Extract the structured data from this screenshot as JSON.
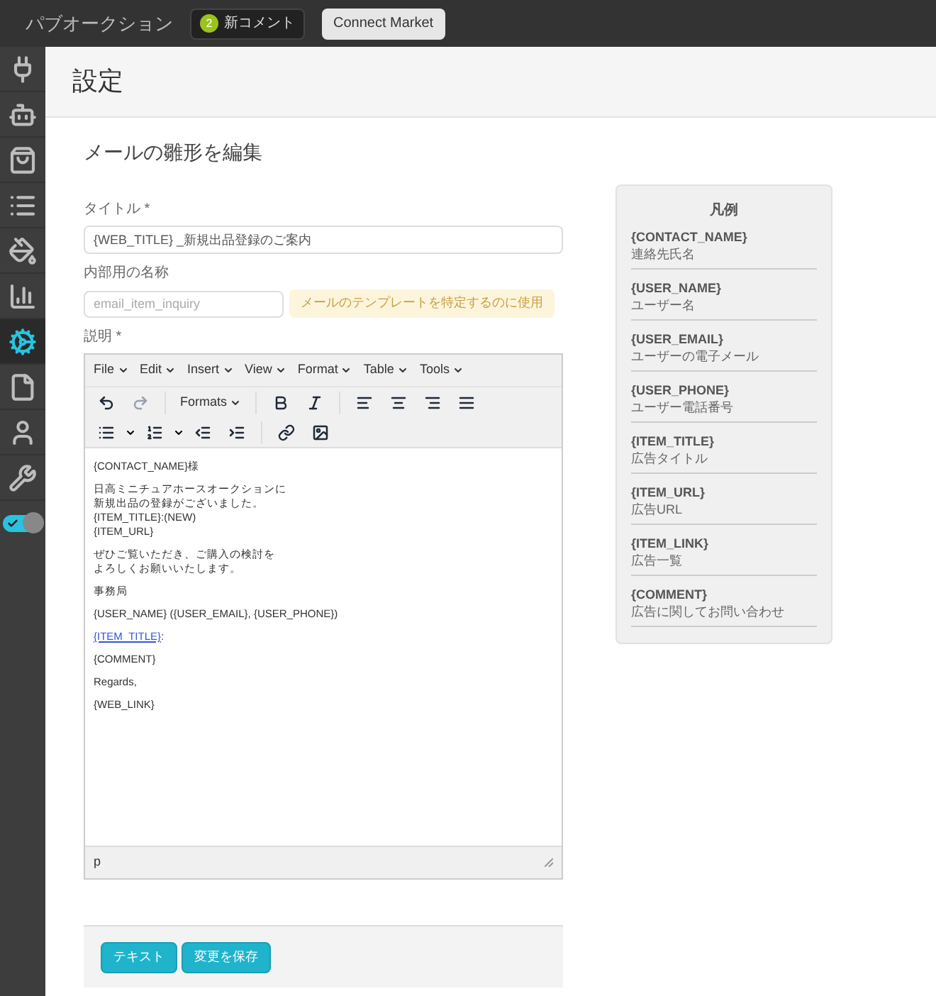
{
  "topbar": {
    "brand": "パブオークション",
    "notification": {
      "count": "2",
      "label": "新コメント"
    },
    "button": "Connect Market"
  },
  "sidebar": {
    "items": [
      {
        "selected": false
      },
      {
        "selected": false
      },
      {
        "selected": false
      },
      {
        "selected": false
      },
      {
        "selected": false
      },
      {
        "selected": false
      },
      {
        "selected": true
      },
      {
        "selected": false
      },
      {
        "selected": false
      },
      {
        "selected": false
      }
    ],
    "toggle": {
      "on": true
    }
  },
  "page": {
    "title": "設定",
    "subtitle": "メールの雛形を編集"
  },
  "form": {
    "title_label": "タイトル *",
    "title_value": "{WEB_TITLE} _新規出品登録のご案内",
    "name_label": "内部用の名称",
    "name_placeholder": "email_item_inquiry",
    "name_hint": "メールのテンプレートを特定するのに使用",
    "description_label": "説明 *"
  },
  "editor": {
    "menus": [
      "File",
      "Edit",
      "Insert",
      "View",
      "Format",
      "Table",
      "Tools"
    ],
    "formats": "Formats",
    "paragraphs": [
      {
        "kind": "text",
        "lines": [
          "{CONTACT_NAME}様"
        ]
      },
      {
        "kind": "text",
        "lines": [
          "日高ミニチュアホースオークションに",
          "新規出品の登録がございました。",
          "{ITEM_TITLE}:(NEW)",
          "{ITEM_URL}"
        ]
      },
      {
        "kind": "text",
        "lines": [
          "ぜひご覧いただき、ご購入の検討を",
          "よろしくお願いいたします。"
        ]
      },
      {
        "kind": "text",
        "lines": [
          "事務局"
        ]
      },
      {
        "kind": "text",
        "lines": [
          "{USER_NAME} ({USER_EMAIL}, {USER_PHONE})"
        ]
      },
      {
        "kind": "link",
        "link": "{ITEM_TITLE}",
        "rest": ":"
      },
      {
        "kind": "text",
        "lines": [
          "{COMMENT}"
        ]
      },
      {
        "kind": "text",
        "lines": [
          "Regards,"
        ]
      },
      {
        "kind": "text",
        "lines": [
          "{WEB_LINK}"
        ]
      }
    ],
    "status": "p"
  },
  "legend": {
    "title": "凡例",
    "items": [
      {
        "code": "{CONTACT_NAME}",
        "meaning": "連絡先氏名"
      },
      {
        "code": "{USER_NAME}",
        "meaning": "ユーザー名"
      },
      {
        "code": "{USER_EMAIL}",
        "meaning": "ユーザーの電子メール"
      },
      {
        "code": "{USER_PHONE}",
        "meaning": "ユーザー電話番号"
      },
      {
        "code": "{ITEM_TITLE}",
        "meaning": "広告タイトル"
      },
      {
        "code": "{ITEM_URL}",
        "meaning": "広告URL"
      },
      {
        "code": "{ITEM_LINK}",
        "meaning": "広告一覧"
      },
      {
        "code": "{COMMENT}",
        "meaning": "広告に関してお問い合わせ"
      }
    ]
  },
  "buttons": [
    "テキスト",
    "変更を保存"
  ]
}
